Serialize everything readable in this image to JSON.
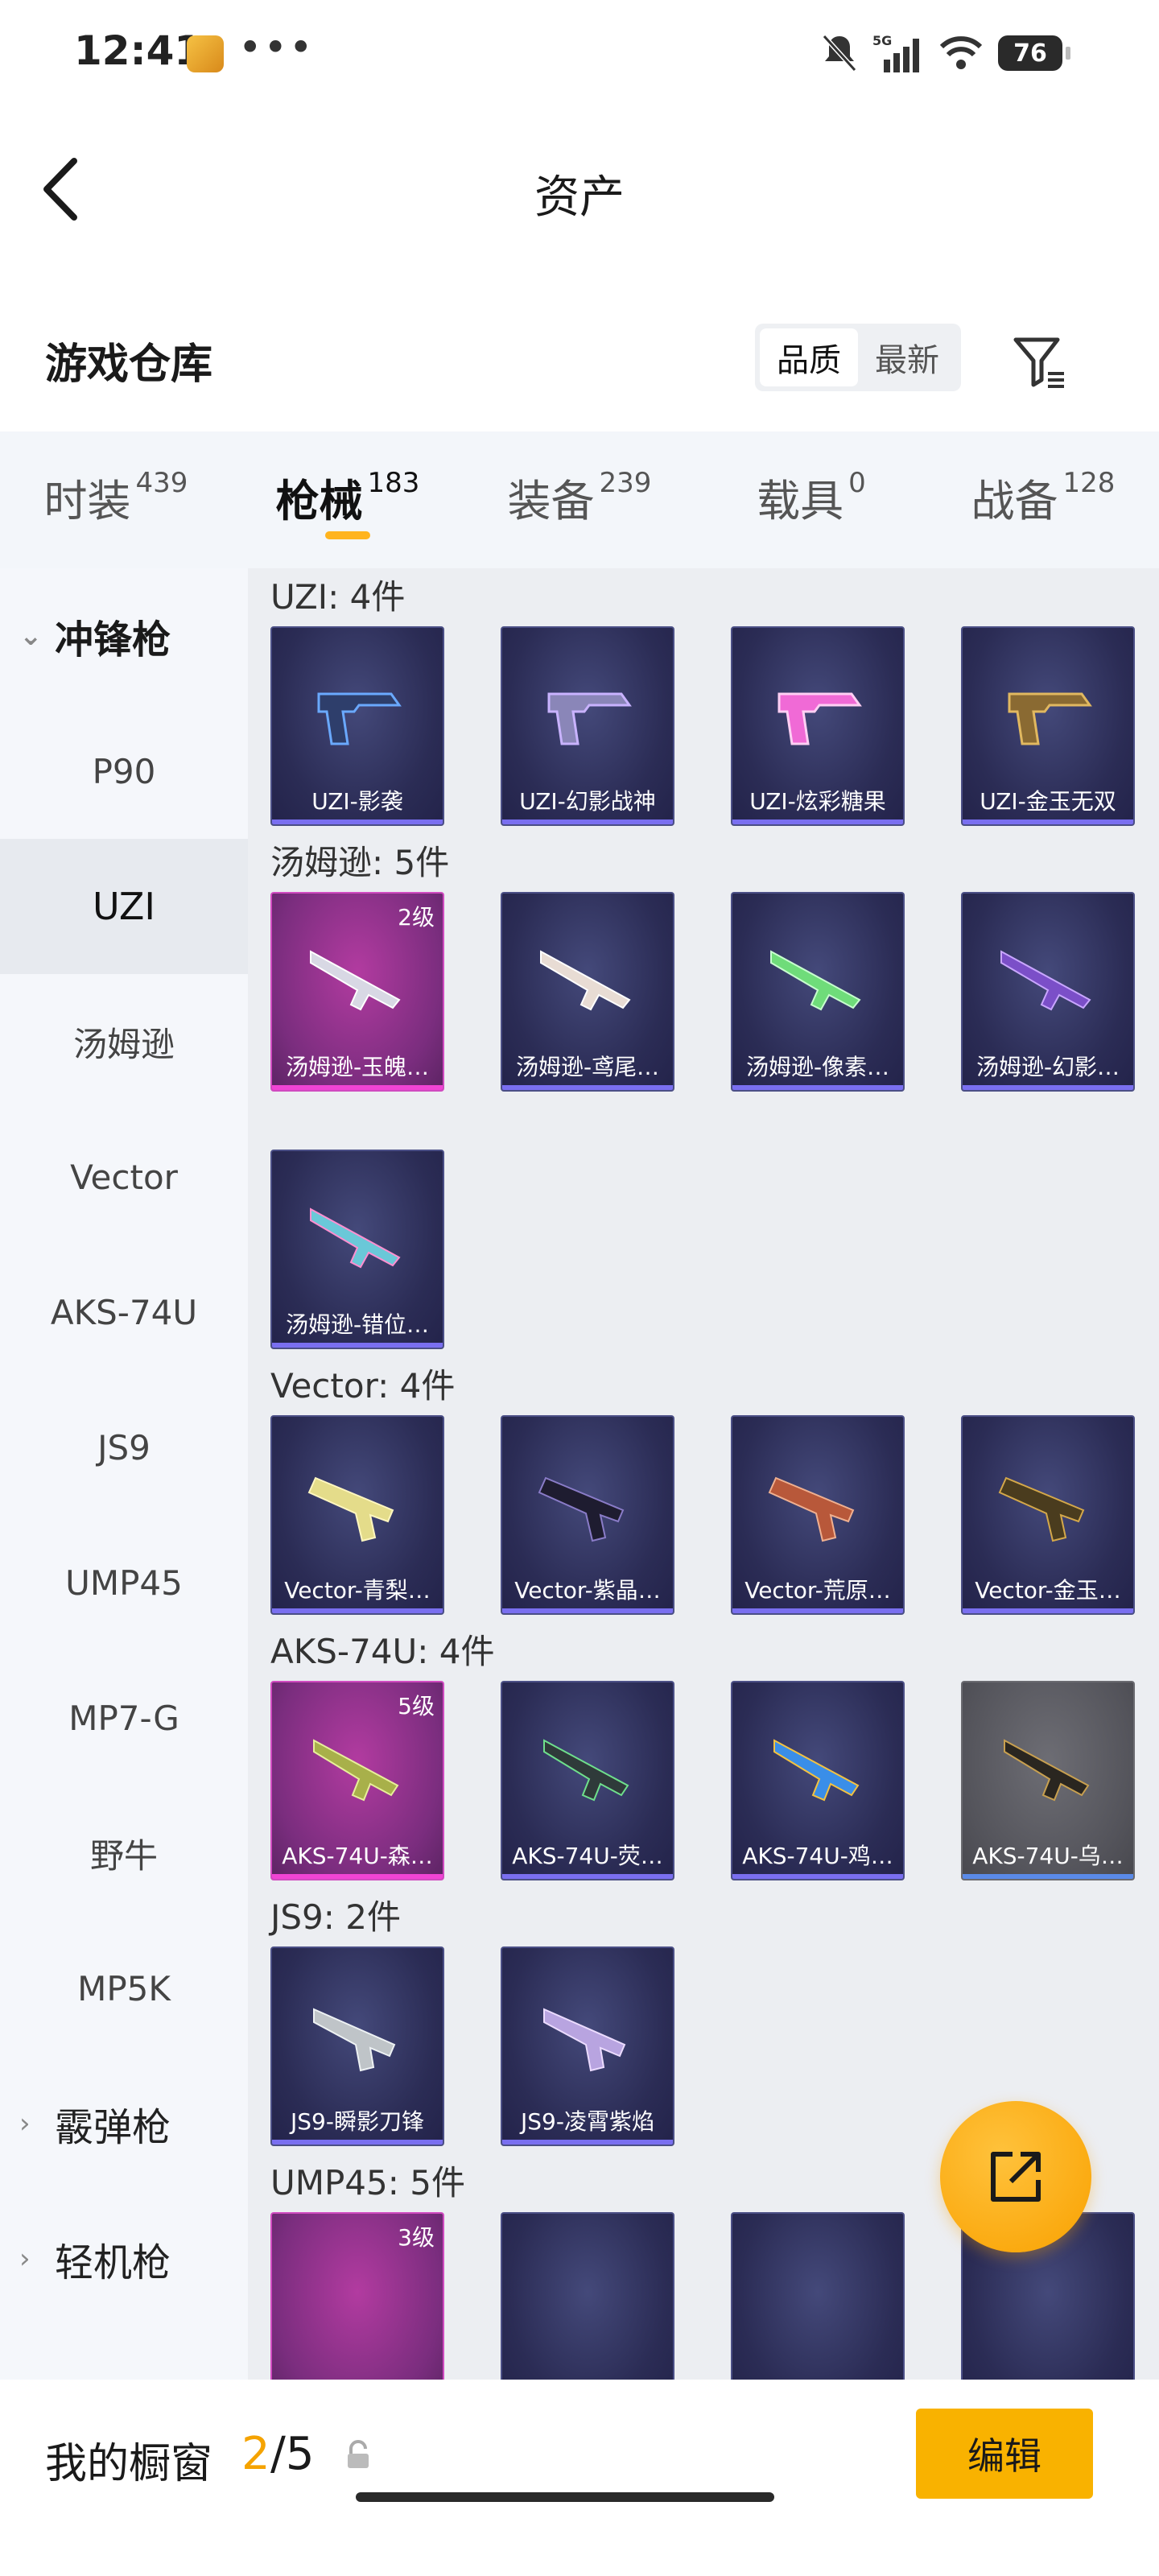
{
  "status": {
    "time": "12:41",
    "dots": "•••",
    "battery": "76",
    "network": "5G"
  },
  "header": {
    "title": "资产"
  },
  "warehouse": {
    "title": "游戏仓库",
    "sort": [
      "品质",
      "最新"
    ]
  },
  "tabs": [
    {
      "label": "时装",
      "count": "439"
    },
    {
      "label": "枪械",
      "count": "183"
    },
    {
      "label": "装备",
      "count": "239"
    },
    {
      "label": "载具",
      "count": "0"
    },
    {
      "label": "战备",
      "count": "128"
    }
  ],
  "side": {
    "cat_open": "冲锋枪",
    "items": [
      "P90",
      "UZI",
      "汤姆逊",
      "Vector",
      "AKS-74U",
      "JS9",
      "UMP45",
      "MP7-G",
      "野牛",
      "MP5K"
    ],
    "cat_shotgun": "霰弹枪",
    "cat_lmg": "轻机枪"
  },
  "groups": [
    {
      "title": "UZI: 4件",
      "items": [
        {
          "name": "UZI-影袭"
        },
        {
          "name": "UZI-幻影战神"
        },
        {
          "name": "UZI-炫彩糖果"
        },
        {
          "name": "UZI-金玉无双"
        }
      ]
    },
    {
      "title": "汤姆逊: 5件",
      "items": [
        {
          "name": "汤姆逊-玉魄…",
          "level": "2级"
        },
        {
          "name": "汤姆逊-鸢尾…"
        },
        {
          "name": "汤姆逊-像素…"
        },
        {
          "name": "汤姆逊-幻影…"
        },
        {
          "name": "汤姆逊-错位…"
        }
      ]
    },
    {
      "title": "Vector: 4件",
      "items": [
        {
          "name": "Vector-青梨…"
        },
        {
          "name": "Vector-紫晶…"
        },
        {
          "name": "Vector-荒原…"
        },
        {
          "name": "Vector-金玉…"
        }
      ]
    },
    {
      "title": "AKS-74U: 4件",
      "items": [
        {
          "name": "AKS-74U-森…",
          "level": "5级"
        },
        {
          "name": "AKS-74U-荧…"
        },
        {
          "name": "AKS-74U-鸡…"
        },
        {
          "name": "AKS-74U-乌…"
        }
      ]
    },
    {
      "title": "JS9: 2件",
      "items": [
        {
          "name": "JS9-瞬影刀锋"
        },
        {
          "name": "JS9-凌霄紫焰"
        }
      ]
    },
    {
      "title": "UMP45: 5件",
      "items": [
        {
          "name": "",
          "level": "3级"
        },
        {
          "name": ""
        },
        {
          "name": ""
        },
        {
          "name": ""
        }
      ]
    }
  ],
  "showcase": {
    "label": "我的橱窗",
    "current": "2",
    "total": "/5",
    "edit": "编辑"
  },
  "colors": {
    "accent": "#f9b200",
    "pink_rarity": "#f044d4",
    "purple_rarity": "#7a6ff0"
  }
}
